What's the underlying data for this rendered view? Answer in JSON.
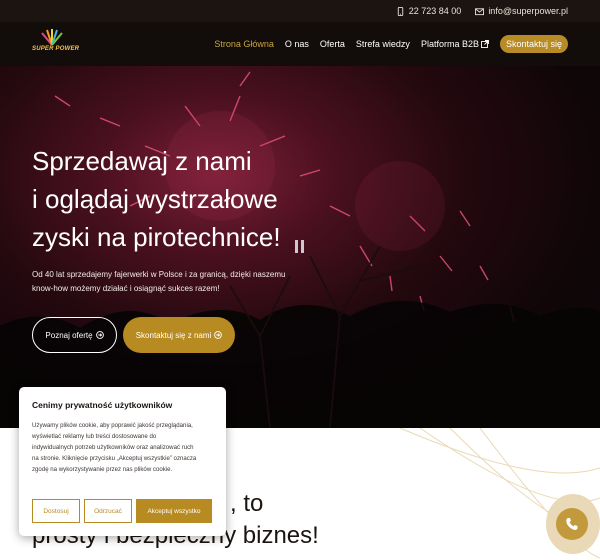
{
  "topbar": {
    "phone": "22 723 84 00",
    "email": "info@superpower.pl"
  },
  "logo": {
    "text": "SUPER POWER"
  },
  "nav": {
    "items": [
      {
        "label": "Strona Główna"
      },
      {
        "label": "O nas"
      },
      {
        "label": "Oferta"
      },
      {
        "label": "Strefa wiedzy"
      },
      {
        "label": "Platforma B2B"
      }
    ],
    "cta": "Skontaktuj się"
  },
  "hero": {
    "title_lines": [
      "Sprzedawaj z nami",
      "i oglądaj wystrzałowe",
      "zyski na pirotechnice!"
    ],
    "lead_lines": [
      "Od 40 lat sprzedajemy fajerwerki w Polsce i za granicą, dzięki naszemu",
      "know-how możemy działać i osiągnąć sukces razem!"
    ],
    "btn_offer": "Poznaj ofertę",
    "btn_contact": "Skontaktuj się z nami"
  },
  "section": {
    "line1": ", to",
    "line2": "prosty i bezpieczny biznes!"
  },
  "cookie": {
    "title": "Cenimy prywatność użytkowników",
    "text_lines": [
      "Używamy plików cookie, aby poprawić jakość przeglądania,",
      "wyświetlać reklamy lub treści dostosowane do",
      "indywidualnych potrzeb użytkowników oraz analizować ruch",
      "na stronie. Kliknięcie przycisku „Akceptuj wszystkie” oznacza",
      "zgodę na wykorzystywanie przez nas plików cookie."
    ],
    "btn_customize": "Dostosuj",
    "btn_reject": "Odrzucać",
    "btn_accept": "Akceptuj wszystko"
  },
  "colors": {
    "gold": "#b88b22",
    "dark": "#120d0a",
    "active_nav": "#c9a443"
  }
}
